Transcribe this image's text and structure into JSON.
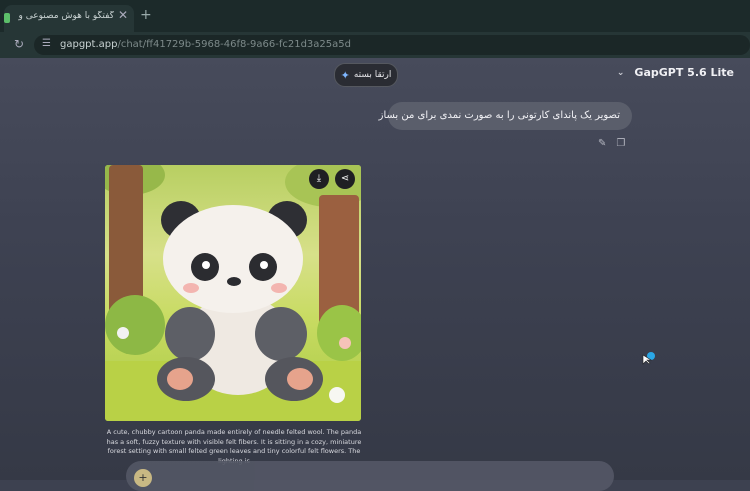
{
  "browser": {
    "tab_title": "گفتگو با هوش مصنوعی و چت...",
    "tab_close": "✕",
    "new_tab": "+",
    "url_host": "gapgpt.app",
    "url_path": "/chat/ff41729b-5968-46f8-9a66-fc21d3a25a5d"
  },
  "header": {
    "upgrade_label": "ارتقا بسته",
    "model_name": "GapGPT 5.6 Lite"
  },
  "conversation": {
    "user_message": "تصویر یک پاندای کارتونی را به صورت نمدی برای من بساز",
    "image_caption": "A cute, chubby cartoon panda made entirely of needle felted wool. The panda has a soft, fuzzy texture with visible felt fibers. It is sitting in a cozy, miniature forest setting with small felted green leaves and tiny colorful felt flowers. The lighting is"
  },
  "icons": {
    "download": "download-icon",
    "share": "share-icon",
    "edit": "edit-icon",
    "copy": "copy-icon",
    "sparkle": "sparkle-icon"
  }
}
